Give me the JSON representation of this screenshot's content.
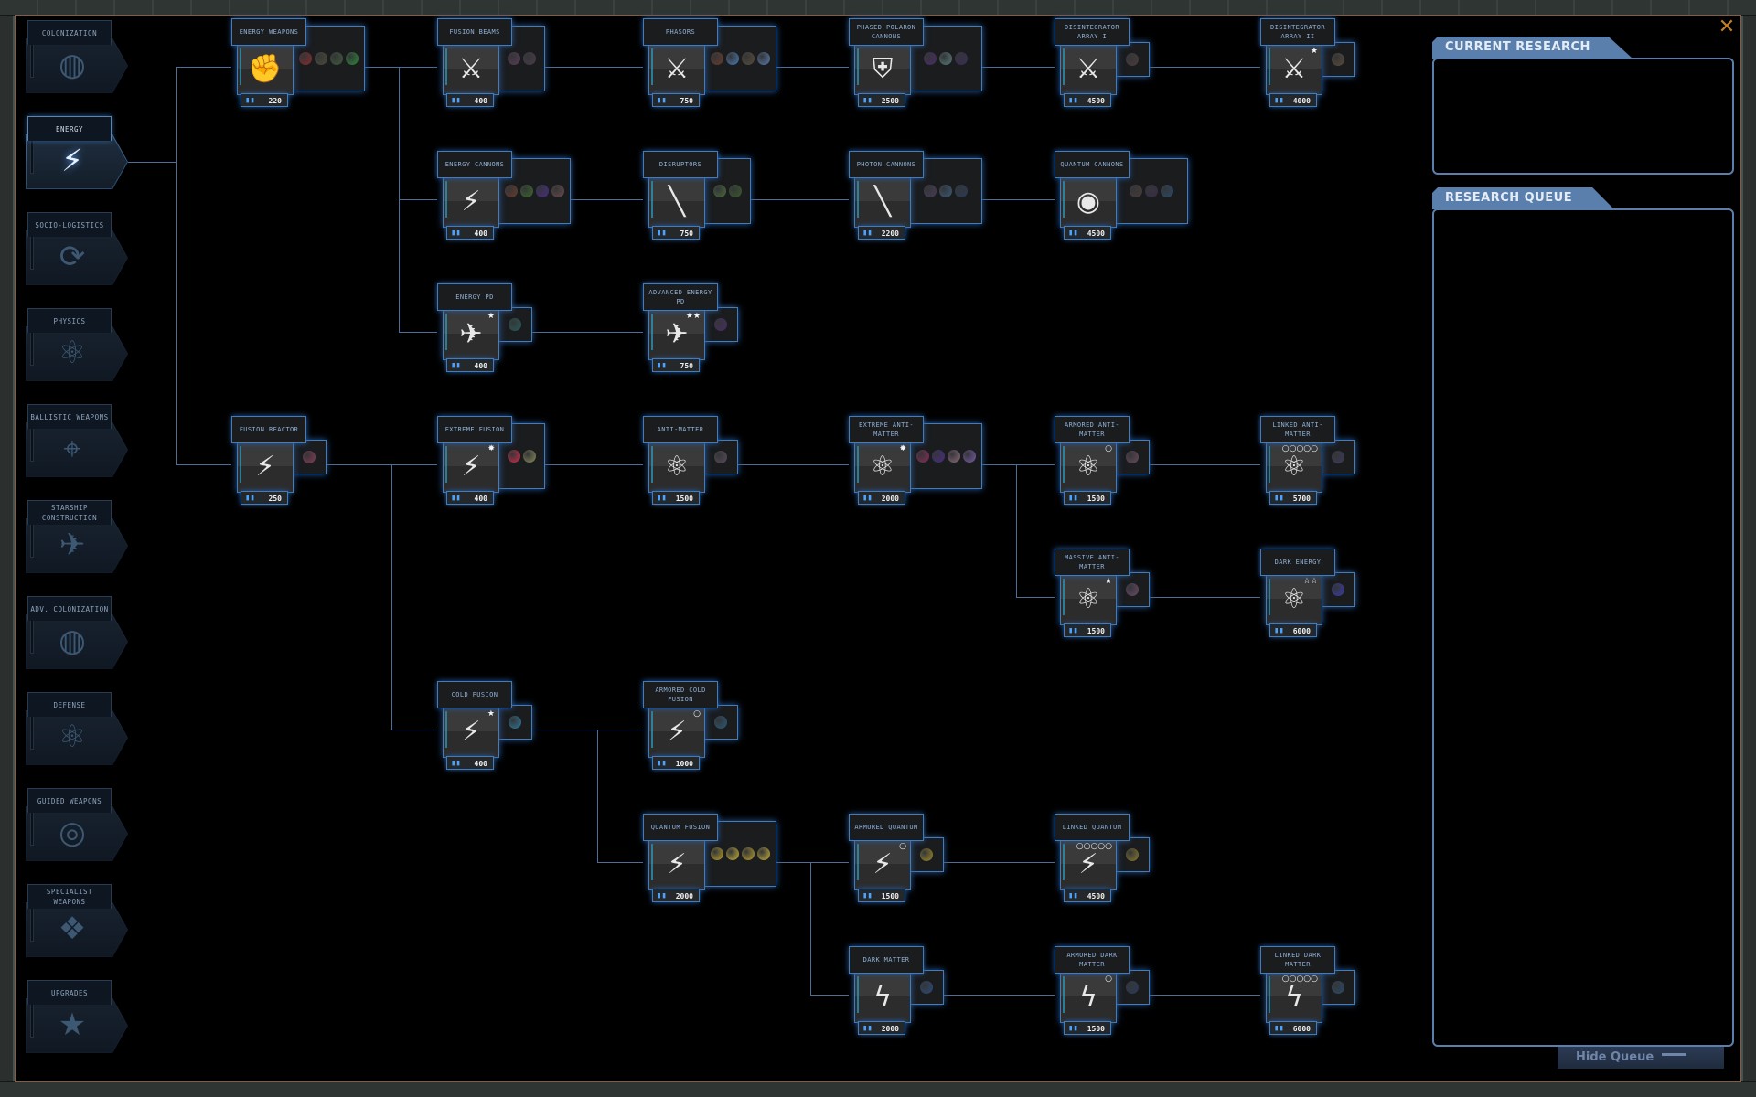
{
  "window": {
    "close_icon": "close-x-icon",
    "accent_color": "#3f7cc0",
    "close_color": "#c0802a"
  },
  "sidebar": {
    "active": "energy",
    "items": [
      {
        "id": "colonization",
        "label": "Colonization",
        "icon": "globe-people-icon",
        "glyph": "◍"
      },
      {
        "id": "energy",
        "label": "Energy",
        "icon": "lightning-icon",
        "glyph": "⚡"
      },
      {
        "id": "socio-logistics",
        "label": "Socio-Logistics",
        "icon": "cycle-arrows-icon",
        "glyph": "⟳"
      },
      {
        "id": "physics",
        "label": "Physics",
        "icon": "atom-icon",
        "glyph": "⚛"
      },
      {
        "id": "ballistic-weapons",
        "label": "Ballistic Weapons",
        "icon": "turret-icon",
        "glyph": "⌖"
      },
      {
        "id": "starship-construction",
        "label": "Starship Construction",
        "icon": "ships-icon",
        "glyph": "✈"
      },
      {
        "id": "adv-colonization",
        "label": "Adv. Colonization",
        "icon": "globe-people-icon",
        "glyph": "◍"
      },
      {
        "id": "defense",
        "label": "Defense",
        "icon": "atom-icon",
        "glyph": "⚛"
      },
      {
        "id": "guided-weapons",
        "label": "Guided Weapons",
        "icon": "target-icon",
        "glyph": "◎"
      },
      {
        "id": "specialist-weapons",
        "label": "Specialist Weapons",
        "icon": "diamond-grid-icon",
        "glyph": "❖"
      },
      {
        "id": "upgrades",
        "label": "Upgrades",
        "icon": "stars-arc-icon",
        "glyph": "★"
      }
    ]
  },
  "tree": {
    "nodes": [
      {
        "id": "energy-weapons",
        "label": "Energy Weapons",
        "cost": "220",
        "col": 0,
        "row": 0,
        "icon": "fist-lightning-icon",
        "glyph": "✊",
        "badge": "",
        "images": 4,
        "colors": [
          "#8a2a2a",
          "#4d4a3a",
          "#3f5a3a",
          "#2a8a3a"
        ]
      },
      {
        "id": "fusion-beams",
        "label": "Fusion Beams",
        "cost": "400",
        "col": 1,
        "row": 0,
        "icon": "beam-emitter-icon",
        "glyph": "⚔",
        "badge": "",
        "images": 2,
        "colors": [
          "#5a3a5a",
          "#4a3a4a"
        ]
      },
      {
        "id": "phasors",
        "label": "Phasors",
        "cost": "750",
        "col": 2,
        "row": 0,
        "icon": "beam-emitter-icon",
        "glyph": "⚔",
        "badge": "",
        "images": 4,
        "colors": [
          "#6a3a2a",
          "#4a7ab0",
          "#5a4a3a",
          "#5a7ab0"
        ]
      },
      {
        "id": "phased-polaron-cannons",
        "label": "Phased Polaron Cannons",
        "cost": "2500",
        "col": 3,
        "row": 0,
        "icon": "shield-beam-icon",
        "glyph": "⛨",
        "badge": "",
        "images": 3,
        "colors": [
          "#4a2a6a",
          "#5a7a7a",
          "#3a2a5a"
        ]
      },
      {
        "id": "disintegrator-array-1",
        "label": "Disintegrator Array I",
        "cost": "4500",
        "col": 4,
        "row": 0,
        "icon": "disintegrator-icon",
        "glyph": "⚔",
        "badge": "",
        "images": 1,
        "colors": [
          "#4a3a3a"
        ]
      },
      {
        "id": "disintegrator-array-2",
        "label": "Disintegrator Array II",
        "cost": "4000",
        "col": 5,
        "row": 0,
        "icon": "disintegrator-icon",
        "glyph": "⚔",
        "badge": "★",
        "images": 1,
        "colors": [
          "#5a4a3a"
        ]
      },
      {
        "id": "energy-cannons",
        "label": "Energy Cannons",
        "cost": "400",
        "col": 1,
        "row": 1,
        "icon": "cannon-icon",
        "glyph": "⚡",
        "badge": "",
        "images": 4,
        "colors": [
          "#6a3a2a",
          "#3a6a2a",
          "#4a2a8a",
          "#6a4a4a"
        ]
      },
      {
        "id": "disruptors",
        "label": "Disruptors",
        "cost": "750",
        "col": 2,
        "row": 1,
        "icon": "disruptor-icon",
        "glyph": "╲",
        "badge": "",
        "images": 2,
        "colors": [
          "#4a6a3a",
          "#3a5a2a"
        ]
      },
      {
        "id": "photon-cannons",
        "label": "Photon Cannons",
        "cost": "2200",
        "col": 3,
        "row": 1,
        "icon": "photon-icon",
        "glyph": "╲",
        "badge": "",
        "images": 3,
        "colors": [
          "#4a3a5a",
          "#3a5a7a",
          "#2a3a5a"
        ]
      },
      {
        "id": "quantum-cannons",
        "label": "Quantum Cannons",
        "cost": "4500",
        "col": 4,
        "row": 1,
        "icon": "quantum-cannon-icon",
        "glyph": "◉",
        "badge": "",
        "images": 3,
        "colors": [
          "#4a3a3a",
          "#3a2a4a",
          "#2a4a6a"
        ]
      },
      {
        "id": "energy-pd",
        "label": "Energy PD",
        "cost": "400",
        "col": 1,
        "row": 2,
        "icon": "point-defense-icon",
        "glyph": "✈",
        "badge": "★",
        "images": 1,
        "colors": [
          "#2a5a5a"
        ]
      },
      {
        "id": "advanced-energy-pd",
        "label": "Advanced Energy PD",
        "cost": "750",
        "col": 2,
        "row": 2,
        "icon": "point-defense-icon",
        "glyph": "✈",
        "badge": "★★",
        "images": 1,
        "colors": [
          "#4a2a6a"
        ]
      },
      {
        "id": "fusion-reactor",
        "label": "Fusion Reactor",
        "cost": "250",
        "col": 0,
        "row": 3,
        "icon": "lightning-icon",
        "glyph": "⚡",
        "badge": "",
        "images": 1,
        "colors": [
          "#8a3a5a"
        ]
      },
      {
        "id": "extreme-fusion",
        "label": "Extreme Fusion",
        "cost": "400",
        "col": 1,
        "row": 3,
        "icon": "lightning-burst-icon",
        "glyph": "⚡",
        "badge": "✸",
        "images": 2,
        "colors": [
          "#d02a4a",
          "#8a8a5a"
        ]
      },
      {
        "id": "anti-matter",
        "label": "Anti-Matter",
        "cost": "1500",
        "col": 2,
        "row": 3,
        "icon": "lightning-atom-icon",
        "glyph": "⚛",
        "badge": "",
        "images": 1,
        "colors": [
          "#5a4a5a"
        ]
      },
      {
        "id": "extreme-anti-matter",
        "label": "Extreme Anti-Matter",
        "cost": "2000",
        "col": 3,
        "row": 3,
        "icon": "lightning-atom-icon",
        "glyph": "⚛",
        "badge": "✸",
        "images": 4,
        "colors": [
          "#8a2a5a",
          "#4a2a8a",
          "#8a6a7a",
          "#7a5aaa"
        ]
      },
      {
        "id": "armored-anti-matter",
        "label": "Armored Anti-Matter",
        "cost": "1500",
        "col": 4,
        "row": 3,
        "icon": "lightning-atom-icon",
        "glyph": "⚛",
        "badge": "○",
        "images": 1,
        "colors": [
          "#6a4a5a"
        ]
      },
      {
        "id": "linked-anti-matter",
        "label": "Linked Anti-Matter",
        "cost": "5700",
        "col": 5,
        "row": 3,
        "icon": "lightning-atom-icon",
        "glyph": "⚛",
        "badge": "○○○○○",
        "images": 1,
        "colors": [
          "#3a3a5a"
        ]
      },
      {
        "id": "massive-anti-matter",
        "label": "Massive Anti-Matter",
        "cost": "1500",
        "col": 4,
        "row": 4,
        "icon": "lightning-atom-icon",
        "glyph": "⚛",
        "badge": "★",
        "images": 1,
        "colors": [
          "#6a4a6a"
        ]
      },
      {
        "id": "dark-energy",
        "label": "Dark Energy",
        "cost": "6000",
        "col": 5,
        "row": 4,
        "icon": "lightning-atom-icon",
        "glyph": "⚛",
        "badge": "☆☆",
        "images": 1,
        "colors": [
          "#3a3aaa"
        ]
      },
      {
        "id": "cold-fusion",
        "label": "Cold Fusion",
        "cost": "400",
        "col": 1,
        "row": 5,
        "icon": "lightning-icon",
        "glyph": "⚡",
        "badge": "★",
        "images": 1,
        "colors": [
          "#2a7a9a"
        ]
      },
      {
        "id": "armored-cold-fusion",
        "label": "Armored Cold Fusion",
        "cost": "1000",
        "col": 2,
        "row": 5,
        "icon": "lightning-icon",
        "glyph": "⚡",
        "badge": "○",
        "images": 1,
        "colors": [
          "#2a5a7a"
        ]
      },
      {
        "id": "quantum-fusion",
        "label": "Quantum Fusion",
        "cost": "2000",
        "col": 2,
        "row": 6,
        "icon": "lightning-molecule-icon",
        "glyph": "⚡",
        "badge": "",
        "images": 4,
        "colors": [
          "#b8a02a",
          "#c8b03a",
          "#b8a02a",
          "#c8b03a"
        ]
      },
      {
        "id": "armored-quantum",
        "label": "Armored Quantum",
        "cost": "1500",
        "col": 3,
        "row": 6,
        "icon": "lightning-molecule-icon",
        "glyph": "⚡",
        "badge": "○",
        "images": 1,
        "colors": [
          "#a08a2a"
        ]
      },
      {
        "id": "linked-quantum",
        "label": "Linked Quantum",
        "cost": "4500",
        "col": 4,
        "row": 6,
        "icon": "lightning-molecule-icon",
        "glyph": "⚡",
        "badge": "○○○○○",
        "images": 1,
        "colors": [
          "#8a7a2a"
        ]
      },
      {
        "id": "dark-matter",
        "label": "Dark Matter",
        "cost": "2000",
        "col": 3,
        "row": 7,
        "icon": "lightning-outline-icon",
        "glyph": "ϟ",
        "badge": "",
        "images": 1,
        "colors": [
          "#2a4a7a"
        ]
      },
      {
        "id": "armored-dark-matter",
        "label": "Armored Dark Matter",
        "cost": "1500",
        "col": 4,
        "row": 7,
        "icon": "lightning-outline-icon",
        "glyph": "ϟ",
        "badge": "○",
        "images": 1,
        "colors": [
          "#2a3a5a"
        ]
      },
      {
        "id": "linked-dark-matter",
        "label": "Linked Dark Matter",
        "cost": "6000",
        "col": 5,
        "row": 7,
        "icon": "lightning-outline-icon",
        "glyph": "ϟ",
        "badge": "○○○○○",
        "images": 1,
        "colors": [
          "#2a4a6a"
        ]
      }
    ],
    "links": [
      [
        "energy-weapons",
        "fusion-beams"
      ],
      [
        "energy-weapons",
        "energy-cannons"
      ],
      [
        "energy-weapons",
        "energy-pd"
      ],
      [
        "fusion-beams",
        "phasors"
      ],
      [
        "phasors",
        "phased-polaron-cannons"
      ],
      [
        "phased-polaron-cannons",
        "disintegrator-array-1"
      ],
      [
        "disintegrator-array-1",
        "disintegrator-array-2"
      ],
      [
        "energy-cannons",
        "disruptors"
      ],
      [
        "disruptors",
        "photon-cannons"
      ],
      [
        "photon-cannons",
        "quantum-cannons"
      ],
      [
        "energy-pd",
        "advanced-energy-pd"
      ],
      [
        "fusion-reactor",
        "extreme-fusion"
      ],
      [
        "fusion-reactor",
        "cold-fusion"
      ],
      [
        "extreme-fusion",
        "anti-matter"
      ],
      [
        "anti-matter",
        "extreme-anti-matter"
      ],
      [
        "extreme-anti-matter",
        "armored-anti-matter"
      ],
      [
        "extreme-anti-matter",
        "massive-anti-matter"
      ],
      [
        "armored-anti-matter",
        "linked-anti-matter"
      ],
      [
        "massive-anti-matter",
        "dark-energy"
      ],
      [
        "cold-fusion",
        "armored-cold-fusion"
      ],
      [
        "cold-fusion",
        "quantum-fusion"
      ],
      [
        "quantum-fusion",
        "armored-quantum"
      ],
      [
        "quantum-fusion",
        "dark-matter"
      ],
      [
        "armored-quantum",
        "linked-quantum"
      ],
      [
        "dark-matter",
        "armored-dark-matter"
      ],
      [
        "armored-dark-matter",
        "linked-dark-matter"
      ]
    ],
    "root_children": [
      "energy-weapons",
      "fusion-reactor"
    ]
  },
  "panels": {
    "current_research": {
      "title": "CURRENT RESEARCH",
      "items": []
    },
    "research_queue": {
      "title": "RESEARCH QUEUE",
      "items": []
    }
  },
  "footer": {
    "hide_queue_label": "Hide Queue"
  },
  "icons": {
    "research_points": "research-flask-icon"
  }
}
